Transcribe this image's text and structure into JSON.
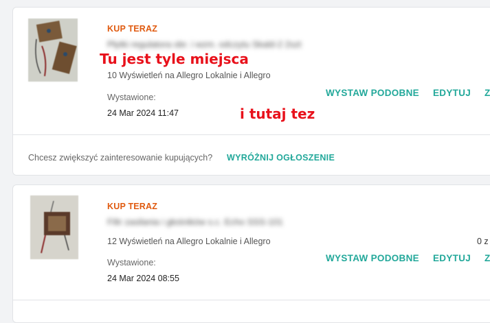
{
  "listings": [
    {
      "badge": "KUP TERAZ",
      "title": "Płytki regulatora obr. i wzm. odczytu Skald-2 2szt",
      "views": "10 Wyświetleń na Allegro Lokalnie i Allegro",
      "listed_label": "Wystawione:",
      "listed_date": "24 Mar 2024 11:47",
      "actions": {
        "similar": "WYSTAW PODOBNE",
        "edit": "EDYTUJ",
        "end": "ZA"
      },
      "promo_question": "Chcesz zwiększyć zainteresowanie kupujących?",
      "promo_button": "WYRÓŻNIJ OGŁOSZENIE"
    },
    {
      "badge": "KUP TERAZ",
      "title": "Filtr zasilania i głośników s.c. Echo SSS-101",
      "views": "12 Wyświetleń na Allegro Lokalnie i Allegro",
      "listed_label": "Wystawione:",
      "listed_date": "24 Mar 2024 08:55",
      "quantity": "0 z",
      "actions": {
        "similar": "WYSTAW PODOBNE",
        "edit": "EDYTUJ",
        "end": "ZA"
      }
    }
  ],
  "annotations": {
    "note1": "Tu jest tyle miejsca",
    "note2": "i tutaj tez"
  },
  "colors": {
    "accent_orange": "#e05a0f",
    "action_teal": "#22a89a",
    "annotation_red": "#e8111b"
  }
}
